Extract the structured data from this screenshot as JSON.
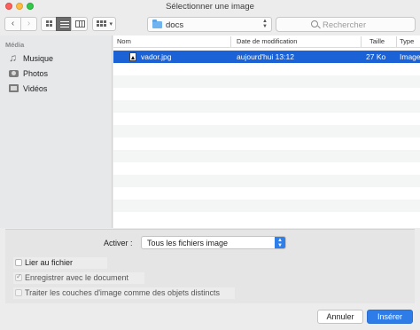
{
  "window": {
    "title": "Sélectionner une image"
  },
  "toolbar": {
    "back_glyph": "‹",
    "forward_glyph": "›",
    "location": "docs",
    "search_placeholder": "Rechercher"
  },
  "sidebar": {
    "header": "Média",
    "items": [
      {
        "label": "Musique",
        "icon": "music-icon"
      },
      {
        "label": "Photos",
        "icon": "camera-icon"
      },
      {
        "label": "Vidéos",
        "icon": "film-icon"
      }
    ]
  },
  "filelist": {
    "columns": {
      "name": "Nom",
      "modified": "Date de modification",
      "size": "Taille",
      "type": "Type"
    },
    "rows": [
      {
        "name": "vador.jpg",
        "modified": "aujourd'hui 13:12",
        "size": "27 Ko",
        "type": "Image",
        "selected": true
      }
    ]
  },
  "options": {
    "activer_label": "Activer :",
    "filter_value": "Tous les fichiers image",
    "checkboxes": [
      {
        "label": "Lier au fichier",
        "checked": false
      },
      {
        "label": "Enregistrer avec le document",
        "checked": true
      },
      {
        "label": "Traiter les couches d'image comme des objets distincts",
        "checked": false
      }
    ]
  },
  "footer": {
    "cancel_label": "Annuler",
    "insert_label": "Insérer"
  },
  "colors": {
    "accent": "#2d7ce8",
    "selection": "#1a62d6"
  }
}
